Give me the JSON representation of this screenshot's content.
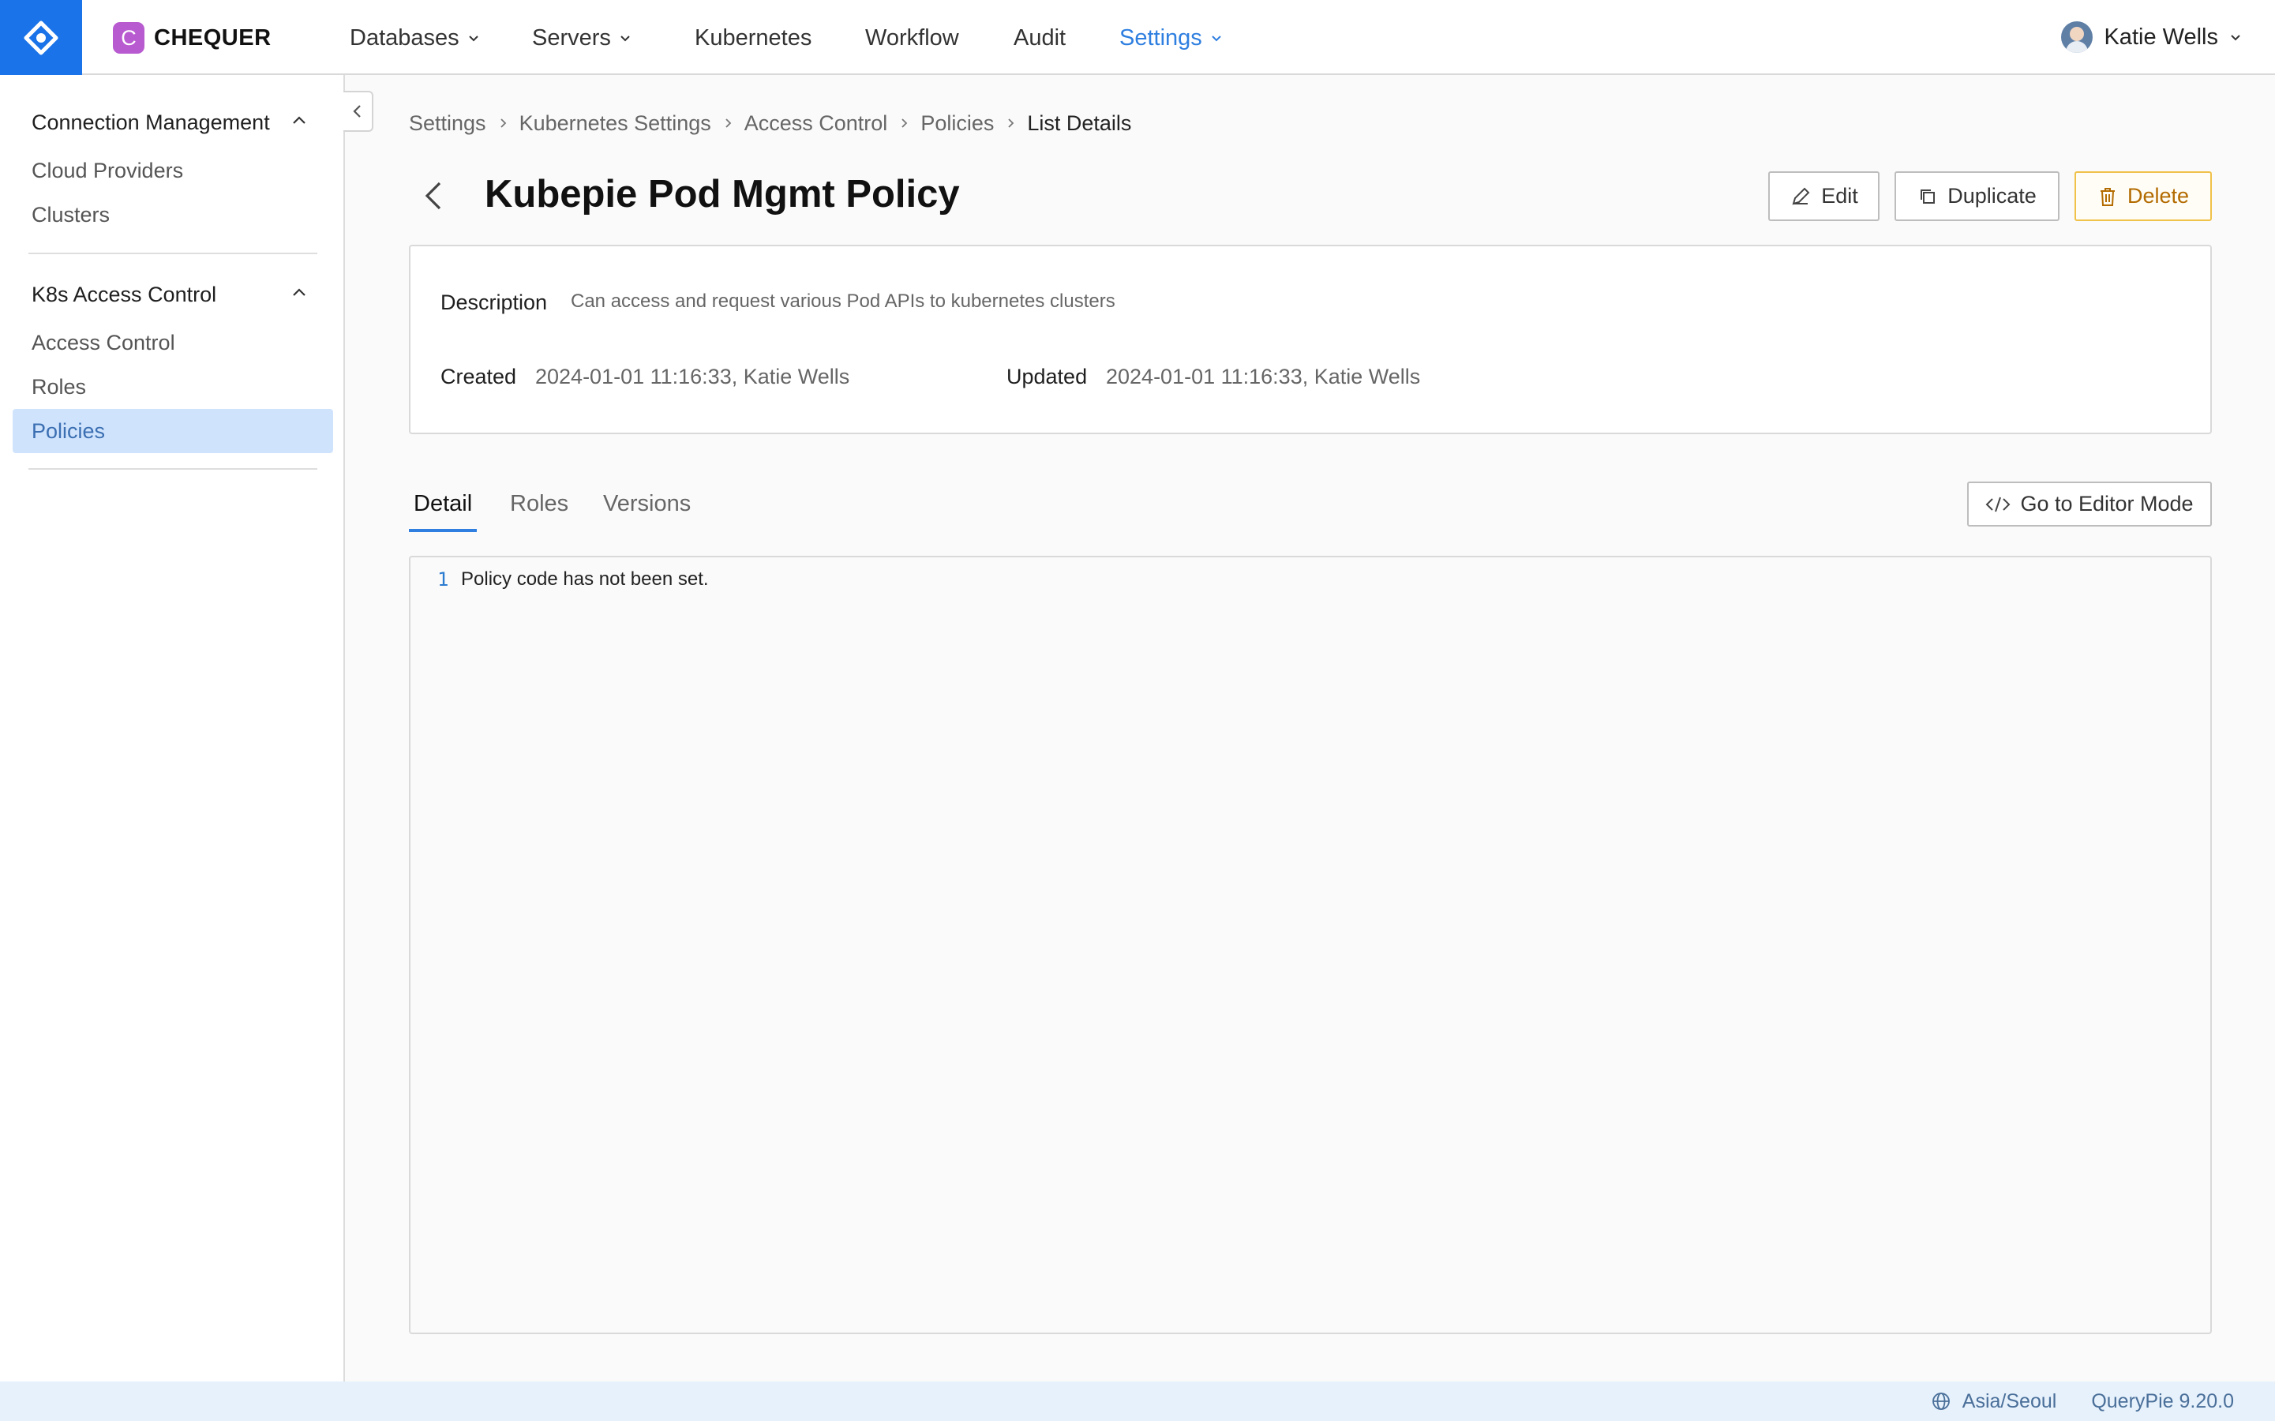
{
  "brand": {
    "badge": "C",
    "name": "CHEQUER"
  },
  "nav": {
    "items": [
      {
        "label": "Databases",
        "dropdown": true
      },
      {
        "label": "Servers",
        "dropdown": true
      },
      {
        "label": "Kubernetes",
        "dropdown": false
      },
      {
        "label": "Workflow",
        "dropdown": false
      },
      {
        "label": "Audit",
        "dropdown": false
      },
      {
        "label": "Settings",
        "dropdown": true,
        "active": true
      }
    ],
    "user": "Katie Wells"
  },
  "sidebar": {
    "groups": [
      {
        "title": "Connection Management",
        "items": [
          "Cloud Providers",
          "Clusters"
        ]
      },
      {
        "title": "K8s Access Control",
        "items": [
          "Access Control",
          "Roles",
          "Policies"
        ]
      }
    ],
    "active_item": "Policies"
  },
  "breadcrumb": [
    "Settings",
    "Kubernetes Settings",
    "Access Control",
    "Policies",
    "List Details"
  ],
  "page": {
    "title": "Kubepie Pod Mgmt Policy",
    "actions": {
      "edit": "Edit",
      "duplicate": "Duplicate",
      "delete": "Delete"
    }
  },
  "details": {
    "description_label": "Description",
    "description": "Can access and request various Pod APIs to kubernetes clusters",
    "created_label": "Created",
    "created": "2024-01-01 11:16:33, Katie Wells",
    "updated_label": "Updated",
    "updated": "2024-01-01 11:16:33, Katie Wells"
  },
  "tabs": [
    "Detail",
    "Roles",
    "Versions"
  ],
  "active_tab": "Detail",
  "editor_button": "Go to Editor Mode",
  "code": {
    "line": "1",
    "text": "Policy code has not been set."
  },
  "footer": {
    "timezone": "Asia/Seoul",
    "version": "QueryPie 9.20.0"
  },
  "colors": {
    "accent": "#2f7fe0",
    "logo_bg": "#1a73e8",
    "active_sidebar": "#cfe3fd",
    "delete": "#f0c24a"
  }
}
